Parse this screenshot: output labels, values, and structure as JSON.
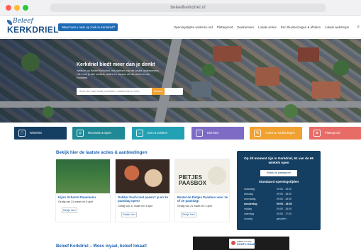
{
  "browser": {
    "url": "beleefkerkdriel.nl"
  },
  "header": {
    "logo_top": "Beleef",
    "logo_main": "KERKDRIEL",
    "ask_button": "Waar bent u naar op zoek in Kerkdriel?",
    "nav": [
      "Openingstijden winkels Lord",
      "Plattegrond",
      "Deelnemers",
      "Lokale acties",
      "Een thuisbezorgen & afhalen",
      "Lokale webshops"
    ],
    "search_icon": "search-icon"
  },
  "hero": {
    "title": "Kerkdriel biedt meer dan je denkt",
    "text": "Welkom op Beleef Kerkdriel, hét platform van de lokale ondernemers. Hier vind je alle winkels, acties en nieuws uit het centrum van Kerkdriel.",
    "search_placeholder": "Zoek hier naar lokale producten, restaurants en meer",
    "search_button": "Zoeken"
  },
  "categories": [
    {
      "label": "Winkelen",
      "color": "#143f63",
      "icon": "bag-icon"
    },
    {
      "label": "Recreatie & Sport",
      "color": "#1f8a96",
      "icon": "bike-icon"
    },
    {
      "label": "Eten & Drinken",
      "color": "#22a0b4",
      "icon": "food-icon"
    },
    {
      "label": "Diensten",
      "color": "#7d6bc5",
      "icon": "service-icon"
    },
    {
      "label": "Acties & Aanbiedingen",
      "color": "#f0a130",
      "icon": "tag-icon"
    },
    {
      "label": "Plattegrond",
      "color": "#e76b66",
      "icon": "map-icon"
    }
  ],
  "actions": {
    "title": "Bekijk hier de laatste acties & aanbiedingen",
    "cards": [
      {
        "title": "Kijon Scharrel Paasmenu",
        "sub": "Geldig van 31 maart t/m 5 april",
        "button": "Bekijk hier!"
      },
      {
        "title": "Dubbel Sushi met pasen? ja en 2e paasdag open!",
        "sub": "Geldig van 31 maart t/m 4 april",
        "button": "Bekijk hier!"
      },
      {
        "title": "Bestel de Pietjes Paasbox voor 1e of 2e paasdag!",
        "sub": "Geldig van 31 maart t/m 4 april",
        "button": "Bekijk hier!"
      }
    ],
    "pbox_title_1": "PIETJES",
    "pbox_title_2": "PAASBOX"
  },
  "hours": {
    "head": "Op dit moment zijn in Kerkdriel, 61 van de 96 winkels open",
    "button": "Bekijk de plattegrond",
    "sub": "Standaard openingstijden",
    "rows": [
      {
        "day": "maandag",
        "time": "09:00 - 18:00"
      },
      {
        "day": "dinsdag",
        "time": "09:00 - 18:00"
      },
      {
        "day": "woensdag",
        "time": "09:00 - 18:00"
      },
      {
        "day": "donderdag",
        "time": "09:00 - 18:00"
      },
      {
        "day": "vrijdag",
        "time": "09:00 - 18:00"
      },
      {
        "day": "zaterdag",
        "time": "09:00 - 17:00"
      },
      {
        "day": "zondag",
        "time": "gesloten"
      }
    ]
  },
  "bottom": {
    "title": "Beleef Kerkdriel – Wees loyaal, beleef lokaal!",
    "promo_t1": "WEES LOYAAL",
    "promo_t2": "KOOP LOKAAL"
  }
}
